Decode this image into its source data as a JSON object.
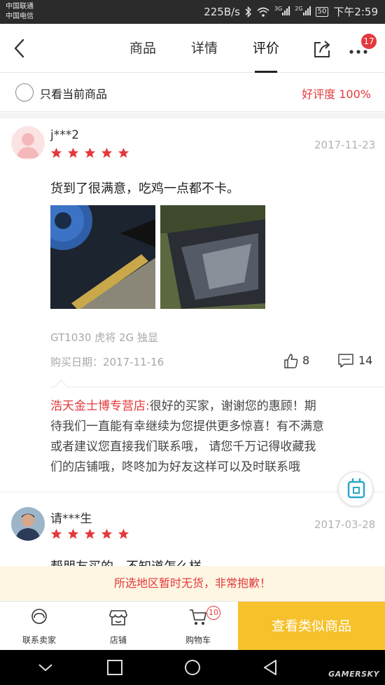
{
  "status_bar": {
    "carrier_1": "中国联通",
    "carrier_2": "中国电信",
    "speed": "225B/s",
    "net_1": "3G",
    "net_2": "2G",
    "battery": "50",
    "time": "下午2:59"
  },
  "header": {
    "tabs": [
      {
        "label": "商品"
      },
      {
        "label": "详情"
      },
      {
        "label": "评价"
      }
    ],
    "active_tab": "评价",
    "notification_count": "17"
  },
  "filter": {
    "checkbox_label": "只看当前商品",
    "checked": false,
    "rating_text": "好评度 100%"
  },
  "reviews": [
    {
      "user": "j***2",
      "date": "2017-11-23",
      "stars": 5,
      "text": "货到了很满意，吃鸡一点都不卡。",
      "spec": "GT1030 虎将 2G 独显",
      "purchase_date": "购买日期：2017-11-16",
      "likes": "8",
      "comments": "14",
      "reply_shop": "浩天金士博专营店:",
      "reply_lines": [
        "很好的买家，谢谢您的惠顾！期",
        "待我们一直能有幸继续为您提供更多惊喜！有不满意",
        "或者建议您直接我们联系哦，  请您千万记得收藏我",
        "们的店铺哦，咚咚加为好友这样可以及时联系哦"
      ]
    },
    {
      "user": "请***生",
      "date": "2017-03-28",
      "stars": 5,
      "text_partial": "帮朋友买的，不知道怎么样"
    }
  ],
  "notice": "所选地区暂时无货，非常抱歉！",
  "bottom_bar": {
    "contact_label": "联系卖家",
    "shop_label": "店铺",
    "cart_label": "购物车",
    "cart_count": "10",
    "similar_label": "查看类似商品"
  },
  "watermark": "GAMERSKY",
  "colors": {
    "accent_red": "#e4393c",
    "cta_yellow": "#f7c12b",
    "notice_bg": "#fdf6e3"
  }
}
